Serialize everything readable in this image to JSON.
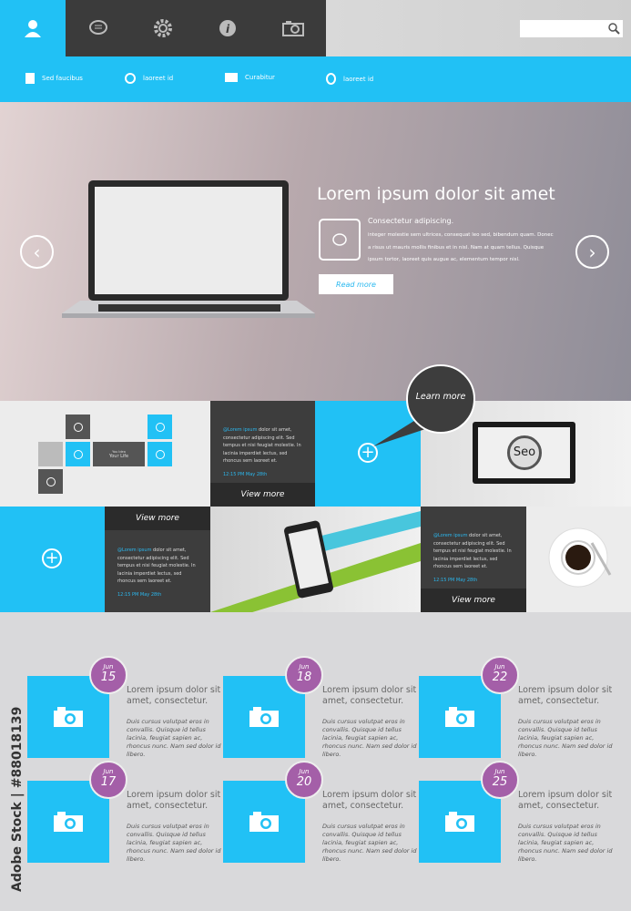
{
  "topbar": {
    "icons": [
      "user-icon",
      "chat-icon",
      "gear-icon",
      "info-icon",
      "camera-icon"
    ],
    "search_placeholder": ""
  },
  "nav": [
    {
      "label": "Sed faucibus",
      "icon": "user-badge-icon"
    },
    {
      "label": "laoreet id",
      "icon": "globe-icon"
    },
    {
      "label": "Curabitur",
      "icon": "camera-icon"
    },
    {
      "label": "laoreet id",
      "icon": "stopwatch-icon"
    }
  ],
  "hero": {
    "title": "Lorem ipsum dolor sit amet",
    "subtitle": "Consectetur adipiscing.",
    "body": "integer molestie sem ultrices, consequat leo sed, bibendum quam. Donec a risus ut mauris mollis finibus et in nisl. Nam at quam tellus. Quisque ipsum tortor, laoreet quis augue ac, elementum tempor nisl.",
    "button": "Read more"
  },
  "tiles": {
    "small": "You Idea",
    "big": "Your Life"
  },
  "post": {
    "handle": "@Lorem ipsum",
    "text": " dolor sit amet, consectetur adipiscing elit. Sed tempus et nisi feugiat molestie. In lacinia imperdiet lectus, sed rhoncus sem laoreet et.",
    "time": "12:15 PM May 28th"
  },
  "learn_more": "Learn more",
  "view_more": "View more",
  "seo": "Seo",
  "colors": {
    "accent": "#21c1f5",
    "dark": "#3d3d3d",
    "date": "#a45fa8"
  },
  "cards": [
    {
      "month": "Jun",
      "day": "15",
      "title": "Lorem ipsum dolor sit amet, consectetur.",
      "text": "Duis cursus volutpat eros in convallis. Quisque id tellus lacinia, feugiat sapien ac, rhoncus nunc. Nam sed dolor id libero."
    },
    {
      "month": "Jun",
      "day": "18",
      "title": "Lorem ipsum dolor sit amet, consectetur.",
      "text": "Duis cursus volutpat eros in convallis. Quisque id tellus lacinia, feugiat sapien ac, rhoncus nunc. Nam sed dolor id libero."
    },
    {
      "month": "Jun",
      "day": "22",
      "title": "Lorem ipsum dolor sit amet, consectetur.",
      "text": "Duis cursus volutpat eros in convallis. Quisque id tellus lacinia, feugiat sapien ac, rhoncus nunc. Nam sed dolor id libero."
    },
    {
      "month": "Jun",
      "day": "17",
      "title": "Lorem ipsum dolor sit amet, consectetur.",
      "text": "Duis cursus volutpat eros in convallis. Quisque id tellus lacinia, feugiat sapien ac, rhoncus nunc. Nam sed dolor id libero."
    },
    {
      "month": "Jun",
      "day": "20",
      "title": "Lorem ipsum dolor sit amet, consectetur.",
      "text": "Duis cursus volutpat eros in convallis. Quisque id tellus lacinia, feugiat sapien ac, rhoncus nunc. Nam sed dolor id libero."
    },
    {
      "month": "Jun",
      "day": "25",
      "title": "Lorem ipsum dolor sit amet, consectetur.",
      "text": "Duis cursus volutpat eros in convallis. Quisque id tellus lacinia, feugiat sapien ac, rhoncus nunc. Nam sed dolor id libero."
    }
  ],
  "watermark": "Adobe Stock | #88018139"
}
